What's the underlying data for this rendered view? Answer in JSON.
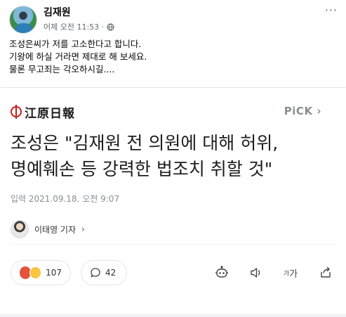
{
  "post": {
    "author": "김재원",
    "time": "어제 오전 11:53 ·",
    "more": "···",
    "lines": [
      "조성은씨가 저를 고소한다고 합니다.",
      "기왕에 하실 거라면 제대로 해 보세요.",
      "물론 무고죄는 각오하시길...."
    ]
  },
  "article": {
    "brand": "江原日報",
    "pick_label": "PiCK",
    "pick_arrow": "›",
    "headline_lines": [
      "조성은 \"김재원 전 의원에 대해 허위,",
      "명예훼손 등 강력한 법조치 취할 것\""
    ],
    "dateline": "입력 2021.09.18. 오전 9:07",
    "reporter": "이태영 기자",
    "reporter_chevron": "›"
  },
  "actions": {
    "reactions_count": "107",
    "comments_count": "42",
    "font_size_label": "가",
    "font_size_small": "가"
  },
  "colors": {
    "brand_red": "#c81e1e",
    "meta_gray": "#65676b",
    "pick_gray": "#8a8d91"
  }
}
